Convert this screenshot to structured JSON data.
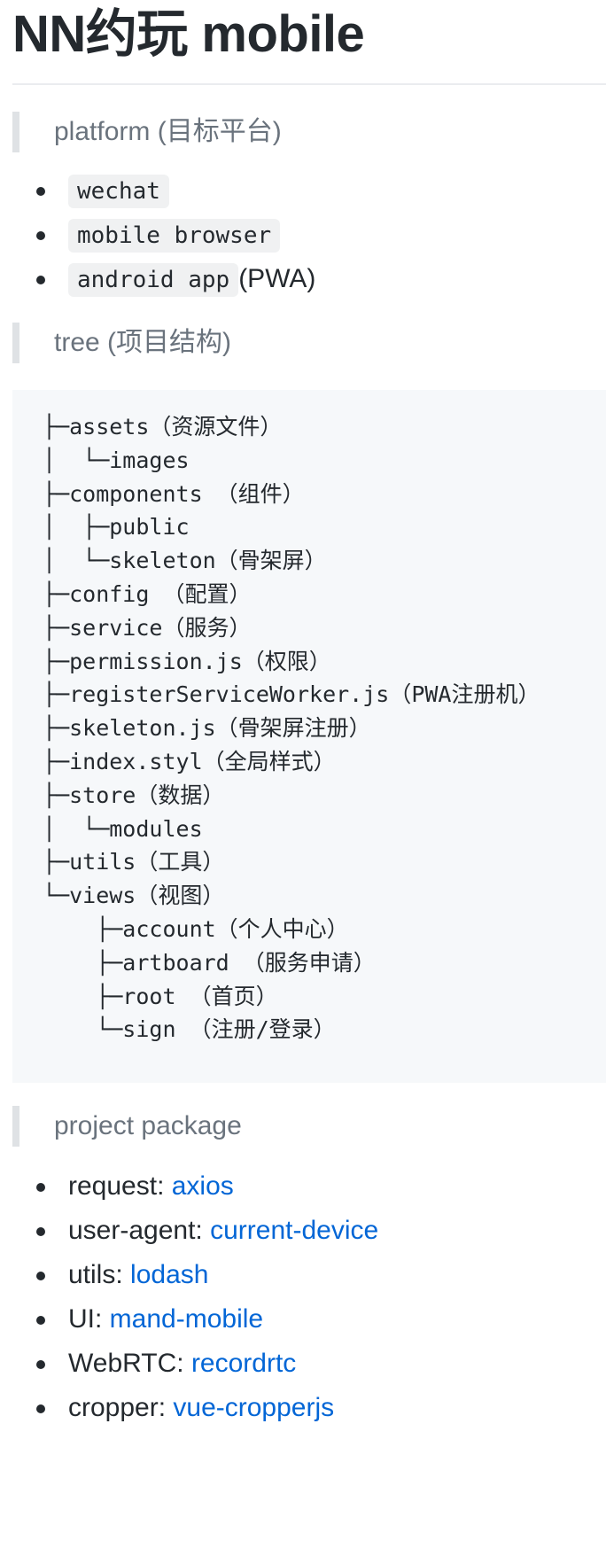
{
  "title": "NN约玩 mobile",
  "platform_heading": "platform (目标平台)",
  "platforms": [
    {
      "code": "wechat",
      "suffix": ""
    },
    {
      "code": "mobile browser",
      "suffix": ""
    },
    {
      "code": "android app",
      "suffix": "(PWA)"
    }
  ],
  "tree_heading": "tree (项目结构)",
  "tree_lines": [
    "├─assets（资源文件）",
    "│  └─images",
    "├─components （组件）",
    "│  ├─public",
    "│  └─skeleton（骨架屏）",
    "├─config （配置）",
    "├─service（服务）",
    "├─permission.js（权限）",
    "├─registerServiceWorker.js（PWA注册机）",
    "├─skeleton.js（骨架屏注册）",
    "├─index.styl（全局样式）",
    "├─store（数据）",
    "│  └─modules",
    "├─utils（工具）",
    "└─views（视图）",
    "    ├─account（个人中心）",
    "    ├─artboard （服务申请）",
    "    ├─root （首页）",
    "    └─sign （注册/登录）"
  ],
  "package_heading": "project package",
  "packages": [
    {
      "label": "request: ",
      "link": "axios"
    },
    {
      "label": "user-agent: ",
      "link": "current-device"
    },
    {
      "label": "utils: ",
      "link": "lodash"
    },
    {
      "label": "UI: ",
      "link": "mand-mobile"
    },
    {
      "label": "WebRTC: ",
      "link": "recordrtc"
    },
    {
      "label": "cropper: ",
      "link": "vue-cropperjs"
    }
  ],
  "colors": {
    "text": "#24292e",
    "muted": "#6a737d",
    "link": "#0366d6",
    "code_bg": "#f6f8fa"
  }
}
